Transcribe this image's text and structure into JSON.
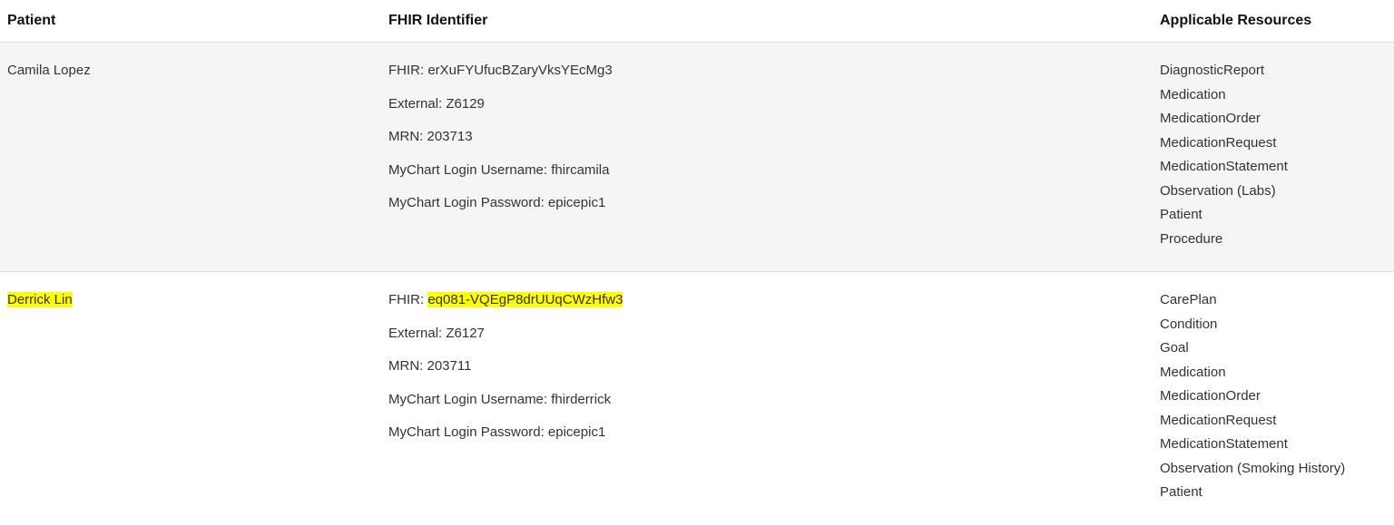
{
  "headers": {
    "patient": "Patient",
    "fhir": "FHIR Identifier",
    "resources": "Applicable Resources"
  },
  "rows": [
    {
      "name": "Camila Lopez",
      "name_hl": false,
      "ids": {
        "fhir_label": "FHIR: ",
        "fhir_value": "erXuFYUfucBZaryVksYEcMg3",
        "fhir_value_hl": false,
        "external": "External: Z6129",
        "mrn": "MRN: 203713",
        "user": "MyChart Login Username: fhircamila",
        "pass": "MyChart Login Password: epicepic1"
      },
      "resources": [
        "DiagnosticReport",
        "Medication",
        "MedicationOrder",
        "MedicationRequest",
        "MedicationStatement",
        "Observation (Labs)",
        "Patient",
        "Procedure"
      ]
    },
    {
      "name": "Derrick Lin",
      "name_hl": true,
      "ids": {
        "fhir_label": "FHIR: ",
        "fhir_value": "eq081-VQEgP8drUUqCWzHfw3",
        "fhir_value_hl": true,
        "external": "External: Z6127",
        "mrn": "MRN: 203711",
        "user": "MyChart Login Username: fhirderrick",
        "pass": "MyChart Login Password: epicepic1"
      },
      "resources": [
        "CarePlan",
        "Condition",
        "Goal",
        "Medication",
        "MedicationOrder",
        "MedicationRequest",
        "MedicationStatement",
        "Observation (Smoking History)",
        "Patient"
      ]
    }
  ]
}
